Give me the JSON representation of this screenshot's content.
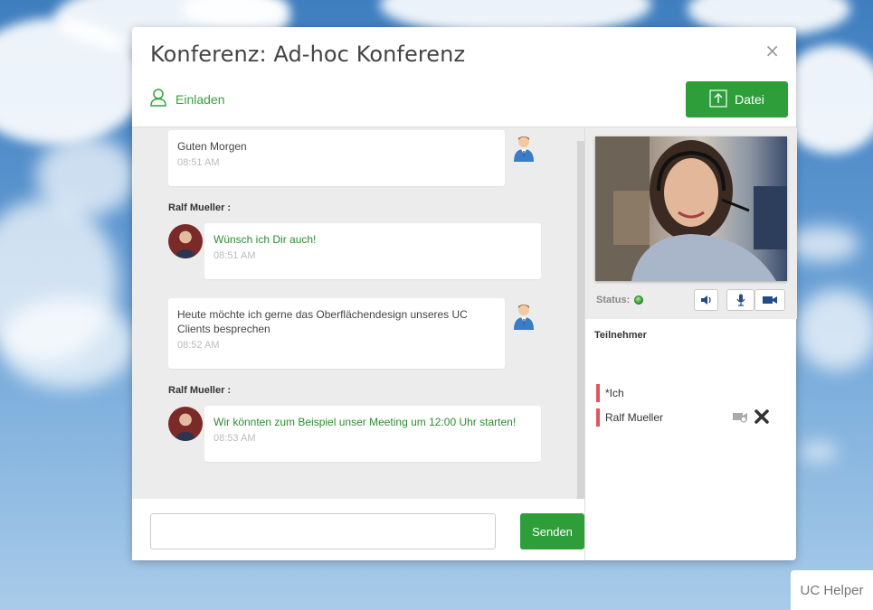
{
  "dialog": {
    "title": "Konferenz: Ad-hoc Konferenz",
    "close_label": "×",
    "invite_label": "Einladen",
    "file_button_label": "Datei"
  },
  "chat": {
    "messages": [
      {
        "text": "Guten Morgen",
        "time": "08:51 AM",
        "sender": ""
      },
      {
        "text": "Wünsch ich Dir auch!",
        "time": "08:51 AM",
        "sender": "Ralf Mueller :"
      },
      {
        "text": "Heute möchte ich gerne das Oberflächendesign unseres UC Clients besprechen",
        "time": "08:52 AM",
        "sender": ""
      },
      {
        "text": "Wir könnten zum Beispiel unser Meeting um 12:00 Uhr starten!",
        "time": "08:53 AM",
        "sender": "Ralf Mueller :"
      }
    ],
    "input_value": "",
    "input_placeholder": "",
    "send_label": "Senden"
  },
  "video": {
    "status_label": "Status:",
    "status_color": "#2b9b28"
  },
  "participants": {
    "title": "Teilnehmer",
    "items": [
      {
        "name": "*Ich"
      },
      {
        "name": "Ralf Mueller"
      }
    ],
    "marker_color": "#e0555f"
  },
  "uc_helper_label": "UC Helper",
  "colors": {
    "accent": "#2e9e3a",
    "accent_text": "#35a13c"
  }
}
